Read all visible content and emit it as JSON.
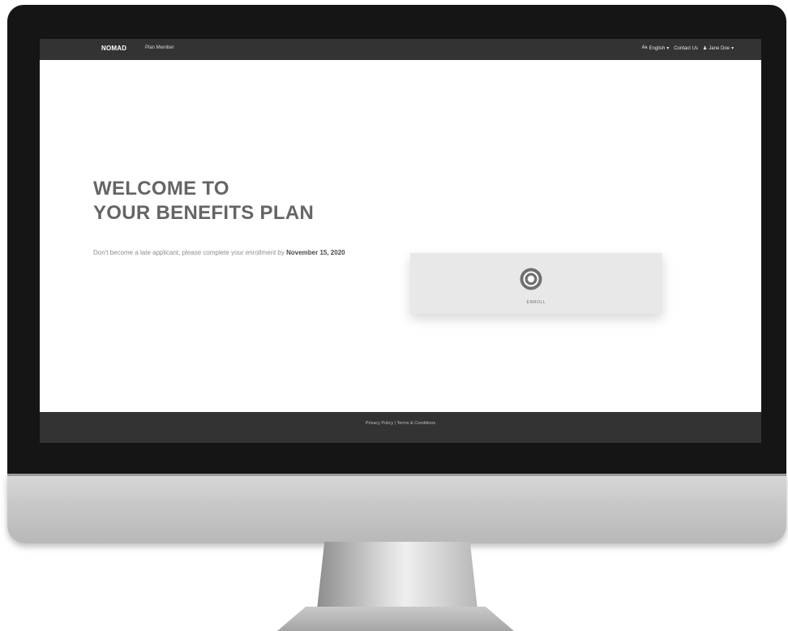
{
  "navbar": {
    "brand": "NOMAD",
    "subtitle": "Plan Member",
    "language_label": "English",
    "contact_label": "Contact Us",
    "user_label": "Jane Doe"
  },
  "hero": {
    "title_line1": "WELCOME TO",
    "title_line2": "YOUR BENEFITS PLAN",
    "desc_prefix": "Don't become a late applicant, please complete your enrollment by ",
    "desc_deadline": "November 15, 2020"
  },
  "enroll": {
    "label": "ENROLL",
    "icon": "target-icon"
  },
  "footer": {
    "privacy_label": "Privacy Policy",
    "separator": " | ",
    "terms_label": "Terms & Conditions"
  },
  "colors": {
    "navbar_bg": "#333333",
    "hero_text": "#656565",
    "card_bg": "#e8e8e8"
  }
}
